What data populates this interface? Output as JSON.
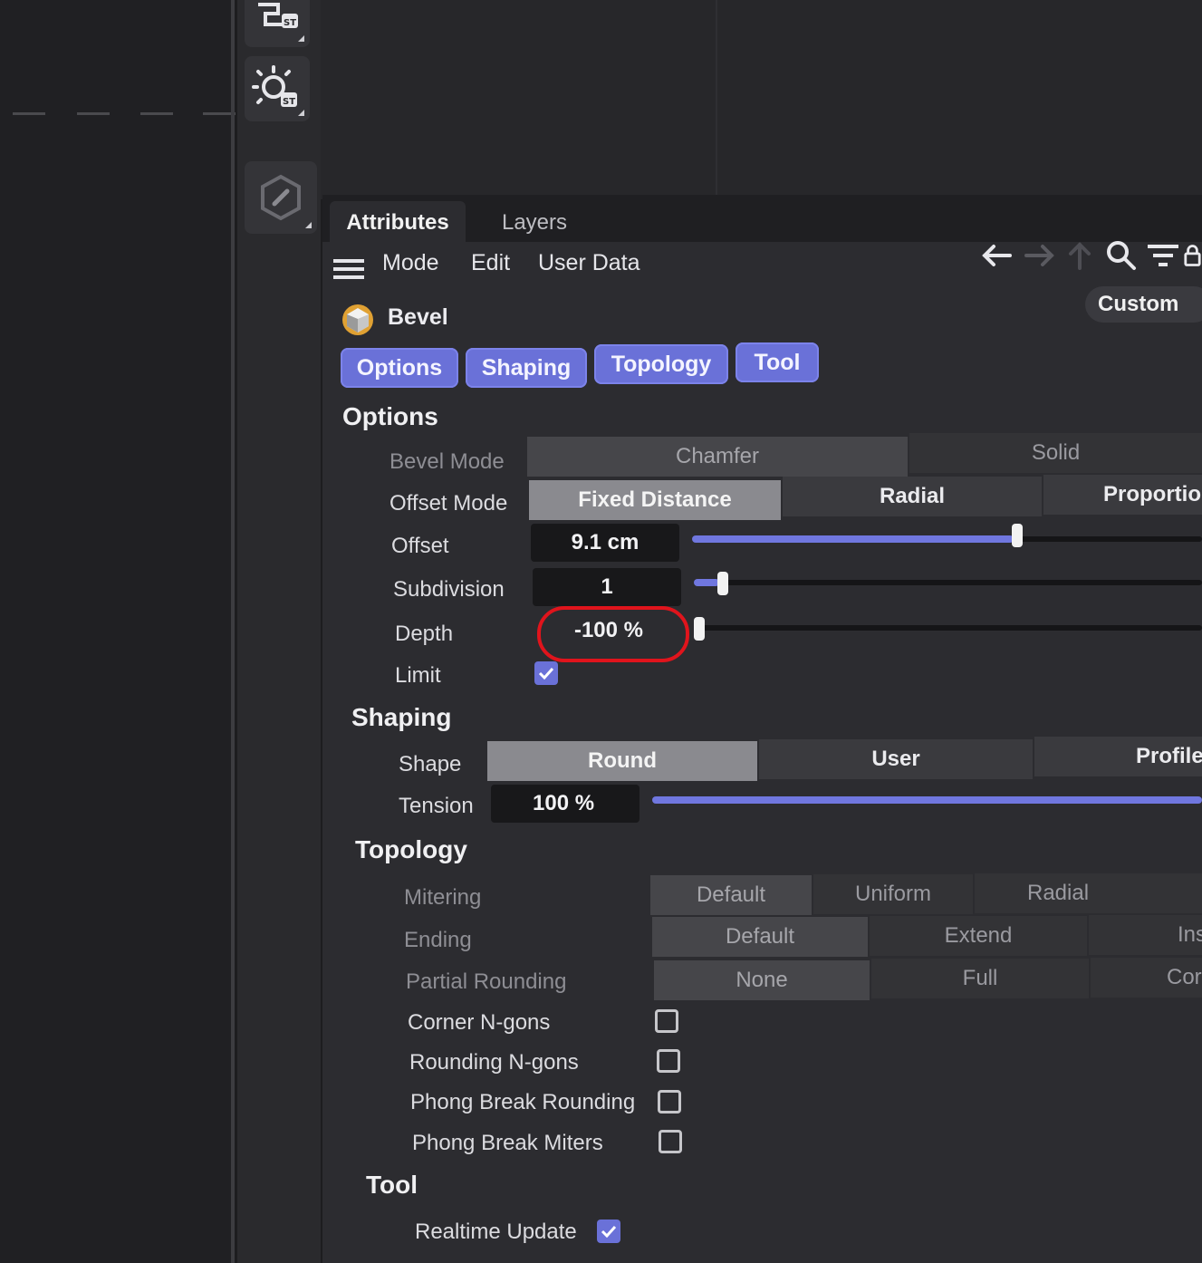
{
  "tabs": [
    "Attributes",
    "Layers"
  ],
  "menu": [
    "Mode",
    "Edit",
    "User Data"
  ],
  "custom_label": "Custom",
  "object_name": "Bevel",
  "chips": [
    "Options",
    "Shaping",
    "Topology",
    "Tool"
  ],
  "options": {
    "title": "Options",
    "bevel_mode_label": "Bevel Mode",
    "bevel_mode_opts": [
      "Chamfer",
      "Solid"
    ],
    "offset_mode_label": "Offset Mode",
    "offset_mode_opts": [
      "Fixed Distance",
      "Radial",
      "Proportio"
    ],
    "offset_label": "Offset",
    "offset_value": "9.1 cm",
    "offset_slider": 0.63,
    "subdivision_label": "Subdivision",
    "subdivision_value": "1",
    "subdivision_slider": 0.05,
    "depth_label": "Depth",
    "depth_value": "-100 %",
    "depth_slider": 0.0,
    "limit_label": "Limit",
    "limit_checked": true
  },
  "shaping": {
    "title": "Shaping",
    "shape_label": "Shape",
    "shape_opts": [
      "Round",
      "User",
      "Profile"
    ],
    "tension_label": "Tension",
    "tension_value": "100 %",
    "tension_slider": 1.0
  },
  "topology": {
    "title": "Topology",
    "mitering_label": "Mitering",
    "mitering_opts": [
      "Default",
      "Uniform",
      "Radial"
    ],
    "ending_label": "Ending",
    "ending_opts": [
      "Default",
      "Extend",
      "Ins"
    ],
    "partial_label": "Partial Rounding",
    "partial_opts": [
      "None",
      "Full",
      "Cor"
    ],
    "checks": [
      {
        "label": "Corner N-gons",
        "checked": false
      },
      {
        "label": "Rounding N-gons",
        "checked": false
      },
      {
        "label": "Phong Break Rounding",
        "checked": false
      },
      {
        "label": "Phong Break Miters",
        "checked": false
      }
    ]
  },
  "tool": {
    "title": "Tool",
    "realtime_label": "Realtime Update",
    "realtime_checked": true
  },
  "colors": {
    "accent": "#6a71d8",
    "highlight_ring": "#e0141c",
    "panel_bg": "#2c2c30"
  },
  "icons": [
    "camera-st-icon",
    "light-st-icon",
    "edit-tool-icon",
    "hamburger-menu-icon",
    "bevel-object-icon",
    "back-arrow-icon",
    "forward-arrow-icon",
    "up-arrow-icon",
    "search-icon",
    "filter-icon",
    "lock-icon",
    "checkmark-icon"
  ]
}
